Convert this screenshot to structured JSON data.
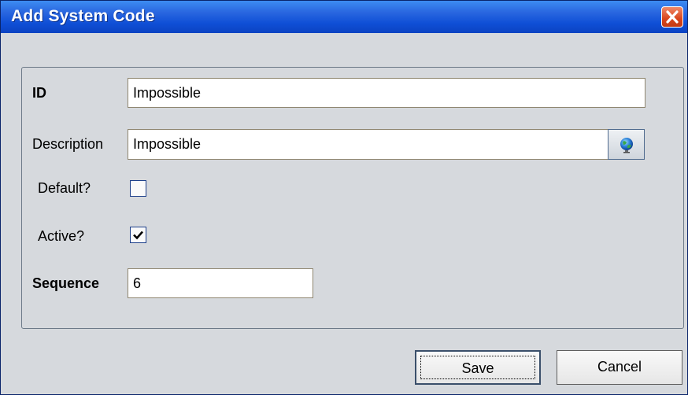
{
  "window": {
    "title": "Add System Code"
  },
  "form": {
    "id": {
      "label": "ID",
      "value": "Impossible"
    },
    "description": {
      "label": "Description",
      "value": "Impossible",
      "icon": "globe-icon"
    },
    "default": {
      "label": "Default?",
      "checked": false
    },
    "active": {
      "label": "Active?",
      "checked": true
    },
    "sequence": {
      "label": "Sequence",
      "value": "6"
    }
  },
  "buttons": {
    "save_label": "Save",
    "cancel_label": "Cancel"
  },
  "colors": {
    "titlebar": "#0f4fd6",
    "close": "#d9451c",
    "background": "#d6d9dd"
  }
}
